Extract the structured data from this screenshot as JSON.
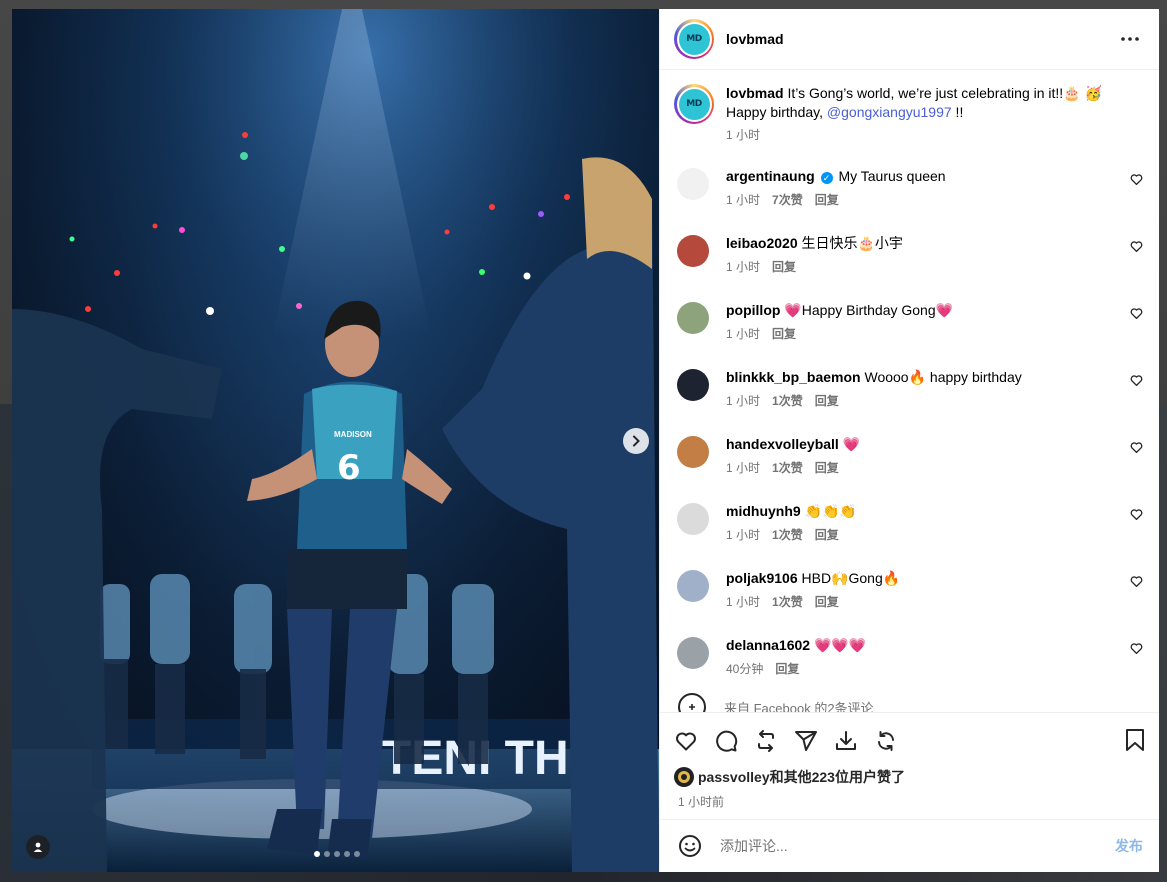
{
  "post": {
    "username": "lovbmad",
    "caption_text": "It’s Gong’s world, we’re just celebrating in it!!🎂 🥳 Happy birthday, ",
    "caption_mention": "@gongxiangyu1997",
    "caption_suffix": " !!",
    "caption_time": "1 小时",
    "brand_logo_text": "MD"
  },
  "comments": [
    {
      "username": "argentinaung",
      "verified": true,
      "text": "My Taurus queen",
      "time": "1 小时",
      "likes": "7次赞",
      "reply": "回复",
      "avatar_color": "#f1f1f1"
    },
    {
      "username": "leibao2020",
      "verified": false,
      "text": "生日快乐🎂小宇",
      "time": "1 小时",
      "likes": "",
      "reply": "回复",
      "avatar_color": "#b4493c"
    },
    {
      "username": "popillop",
      "verified": false,
      "text": "💗Happy Birthday Gong💗",
      "time": "1 小时",
      "likes": "",
      "reply": "回复",
      "avatar_color": "#8da37b"
    },
    {
      "username": "blinkkk_bp_baemon",
      "verified": false,
      "text": "Woooo🔥 happy birthday",
      "time": "1 小时",
      "likes": "1次赞",
      "reply": "回复",
      "avatar_color": "#1d2330"
    },
    {
      "username": "handexvolleyball",
      "verified": false,
      "text": "💗",
      "time": "1 小时",
      "likes": "1次赞",
      "reply": "回复",
      "avatar_color": "#c27e45"
    },
    {
      "username": "midhuynh9",
      "verified": false,
      "text": "👏👏👏",
      "time": "1 小时",
      "likes": "1次赞",
      "reply": "回复",
      "avatar_color": "#dbdbdb"
    },
    {
      "username": "poljak9106",
      "verified": false,
      "text": "HBD🙌Gong🔥",
      "time": "1 小时",
      "likes": "1次赞",
      "reply": "回复",
      "avatar_color": "#9fb0c8"
    },
    {
      "username": "delanna1602",
      "verified": false,
      "text": "💗💗💗",
      "time": "40分钟",
      "likes": "",
      "reply": "回复",
      "avatar_color": "#9aa2a8"
    }
  ],
  "more_comments_text": "来自 Facebook 的2条评论",
  "likes": {
    "text": "passvolley和其他223位用户赞了",
    "time": "1 小时前"
  },
  "add_comment": {
    "placeholder": "添加评论...",
    "post_label": "发布"
  },
  "media": {
    "carousel_count": 5,
    "carousel_index": 1,
    "jersey_number": "6",
    "sponsor_text": "MADISON",
    "banner_text": "TENI THO"
  },
  "icons": {
    "heart": "heart-icon",
    "comment": "comment-icon",
    "repost": "repost-icon",
    "share": "paper-plane-icon",
    "download": "download-icon",
    "refresh": "sync-icon",
    "save": "bookmark-icon",
    "more": "more-dots-icon"
  }
}
